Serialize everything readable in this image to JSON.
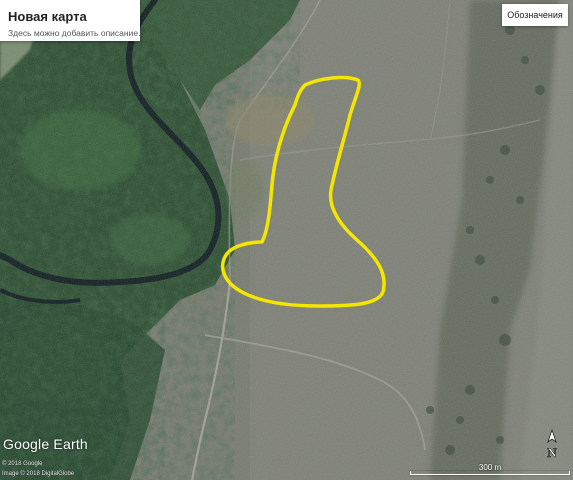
{
  "map": {
    "title": "Новая карта",
    "description": "Здесь можно добавить описание.",
    "legend_button_label": "Обозначения",
    "logo_text": "Google Earth",
    "credits": [
      "© 2018 Google",
      "Image © 2018 DigitalGlobe"
    ],
    "scale_label": "300 m",
    "compass_label": "N",
    "outline_color": "#f5e600",
    "colors": {
      "forest": "#1f3a22",
      "river": "#0f1f22",
      "steppe": "#7b7f72"
    },
    "icons": [
      "compass-icon"
    ]
  }
}
